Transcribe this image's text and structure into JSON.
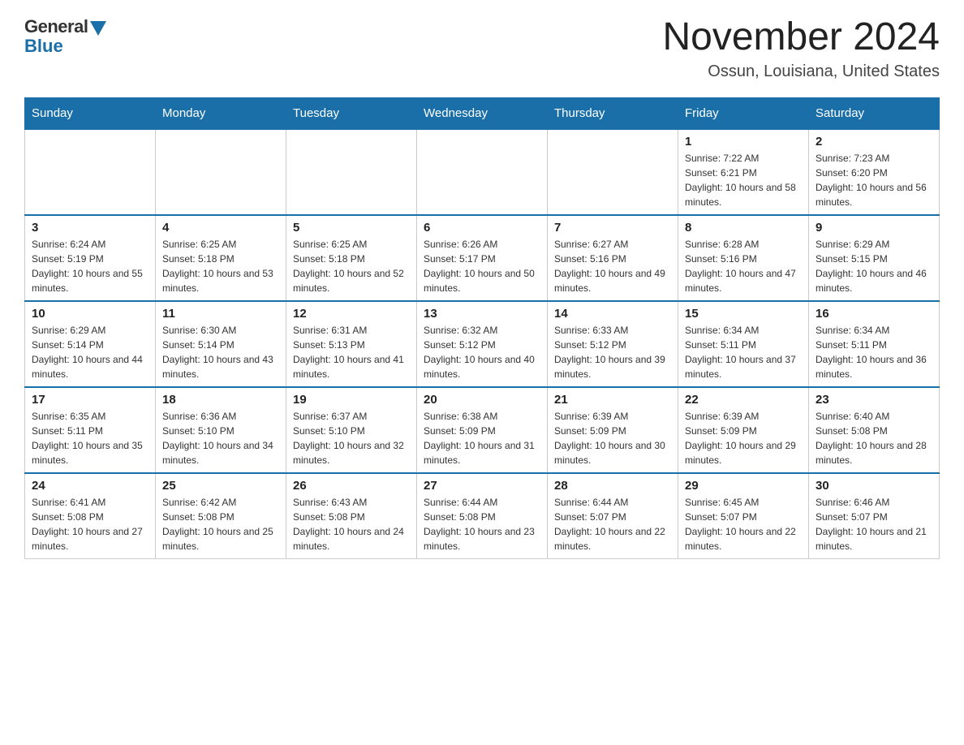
{
  "header": {
    "logo_general": "General",
    "logo_blue": "Blue",
    "month_title": "November 2024",
    "location": "Ossun, Louisiana, United States"
  },
  "days_of_week": [
    "Sunday",
    "Monday",
    "Tuesday",
    "Wednesday",
    "Thursday",
    "Friday",
    "Saturday"
  ],
  "weeks": [
    [
      {
        "day": "",
        "info": ""
      },
      {
        "day": "",
        "info": ""
      },
      {
        "day": "",
        "info": ""
      },
      {
        "day": "",
        "info": ""
      },
      {
        "day": "",
        "info": ""
      },
      {
        "day": "1",
        "info": "Sunrise: 7:22 AM\nSunset: 6:21 PM\nDaylight: 10 hours and 58 minutes."
      },
      {
        "day": "2",
        "info": "Sunrise: 7:23 AM\nSunset: 6:20 PM\nDaylight: 10 hours and 56 minutes."
      }
    ],
    [
      {
        "day": "3",
        "info": "Sunrise: 6:24 AM\nSunset: 5:19 PM\nDaylight: 10 hours and 55 minutes."
      },
      {
        "day": "4",
        "info": "Sunrise: 6:25 AM\nSunset: 5:18 PM\nDaylight: 10 hours and 53 minutes."
      },
      {
        "day": "5",
        "info": "Sunrise: 6:25 AM\nSunset: 5:18 PM\nDaylight: 10 hours and 52 minutes."
      },
      {
        "day": "6",
        "info": "Sunrise: 6:26 AM\nSunset: 5:17 PM\nDaylight: 10 hours and 50 minutes."
      },
      {
        "day": "7",
        "info": "Sunrise: 6:27 AM\nSunset: 5:16 PM\nDaylight: 10 hours and 49 minutes."
      },
      {
        "day": "8",
        "info": "Sunrise: 6:28 AM\nSunset: 5:16 PM\nDaylight: 10 hours and 47 minutes."
      },
      {
        "day": "9",
        "info": "Sunrise: 6:29 AM\nSunset: 5:15 PM\nDaylight: 10 hours and 46 minutes."
      }
    ],
    [
      {
        "day": "10",
        "info": "Sunrise: 6:29 AM\nSunset: 5:14 PM\nDaylight: 10 hours and 44 minutes."
      },
      {
        "day": "11",
        "info": "Sunrise: 6:30 AM\nSunset: 5:14 PM\nDaylight: 10 hours and 43 minutes."
      },
      {
        "day": "12",
        "info": "Sunrise: 6:31 AM\nSunset: 5:13 PM\nDaylight: 10 hours and 41 minutes."
      },
      {
        "day": "13",
        "info": "Sunrise: 6:32 AM\nSunset: 5:12 PM\nDaylight: 10 hours and 40 minutes."
      },
      {
        "day": "14",
        "info": "Sunrise: 6:33 AM\nSunset: 5:12 PM\nDaylight: 10 hours and 39 minutes."
      },
      {
        "day": "15",
        "info": "Sunrise: 6:34 AM\nSunset: 5:11 PM\nDaylight: 10 hours and 37 minutes."
      },
      {
        "day": "16",
        "info": "Sunrise: 6:34 AM\nSunset: 5:11 PM\nDaylight: 10 hours and 36 minutes."
      }
    ],
    [
      {
        "day": "17",
        "info": "Sunrise: 6:35 AM\nSunset: 5:11 PM\nDaylight: 10 hours and 35 minutes."
      },
      {
        "day": "18",
        "info": "Sunrise: 6:36 AM\nSunset: 5:10 PM\nDaylight: 10 hours and 34 minutes."
      },
      {
        "day": "19",
        "info": "Sunrise: 6:37 AM\nSunset: 5:10 PM\nDaylight: 10 hours and 32 minutes."
      },
      {
        "day": "20",
        "info": "Sunrise: 6:38 AM\nSunset: 5:09 PM\nDaylight: 10 hours and 31 minutes."
      },
      {
        "day": "21",
        "info": "Sunrise: 6:39 AM\nSunset: 5:09 PM\nDaylight: 10 hours and 30 minutes."
      },
      {
        "day": "22",
        "info": "Sunrise: 6:39 AM\nSunset: 5:09 PM\nDaylight: 10 hours and 29 minutes."
      },
      {
        "day": "23",
        "info": "Sunrise: 6:40 AM\nSunset: 5:08 PM\nDaylight: 10 hours and 28 minutes."
      }
    ],
    [
      {
        "day": "24",
        "info": "Sunrise: 6:41 AM\nSunset: 5:08 PM\nDaylight: 10 hours and 27 minutes."
      },
      {
        "day": "25",
        "info": "Sunrise: 6:42 AM\nSunset: 5:08 PM\nDaylight: 10 hours and 25 minutes."
      },
      {
        "day": "26",
        "info": "Sunrise: 6:43 AM\nSunset: 5:08 PM\nDaylight: 10 hours and 24 minutes."
      },
      {
        "day": "27",
        "info": "Sunrise: 6:44 AM\nSunset: 5:08 PM\nDaylight: 10 hours and 23 minutes."
      },
      {
        "day": "28",
        "info": "Sunrise: 6:44 AM\nSunset: 5:07 PM\nDaylight: 10 hours and 22 minutes."
      },
      {
        "day": "29",
        "info": "Sunrise: 6:45 AM\nSunset: 5:07 PM\nDaylight: 10 hours and 22 minutes."
      },
      {
        "day": "30",
        "info": "Sunrise: 6:46 AM\nSunset: 5:07 PM\nDaylight: 10 hours and 21 minutes."
      }
    ]
  ]
}
